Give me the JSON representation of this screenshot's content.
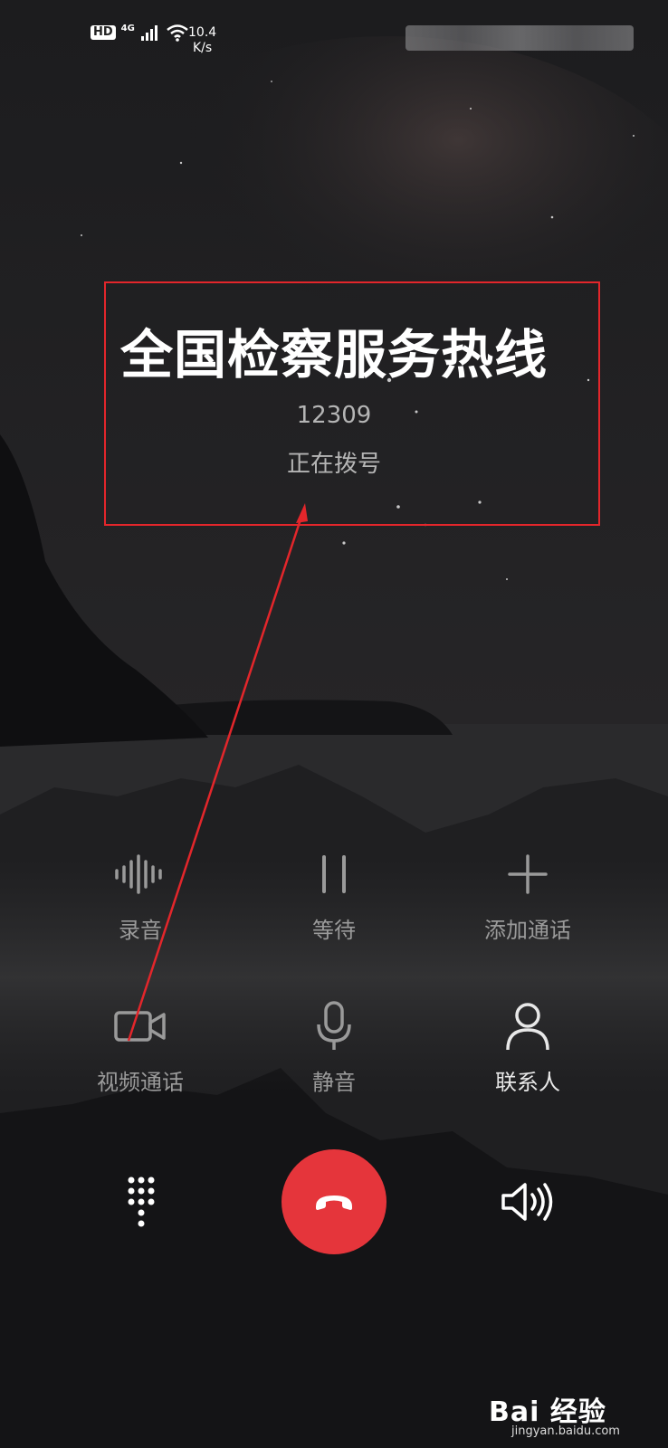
{
  "status_bar": {
    "hd_badge": "HD",
    "network": "4G",
    "speed_value": "10.4",
    "speed_unit": "K/s",
    "icons": [
      "signal-icon",
      "wifi-icon"
    ]
  },
  "call": {
    "caller_name": "全国检察服务热线",
    "number": "12309",
    "status": "正在拨号"
  },
  "controls": {
    "row1": [
      {
        "label": "录音",
        "icon": "record-waveform-icon"
      },
      {
        "label": "等待",
        "icon": "pause-icon"
      },
      {
        "label": "添加通话",
        "icon": "plus-icon"
      }
    ],
    "row2": [
      {
        "label": "视频通话",
        "icon": "video-camera-icon"
      },
      {
        "label": "静音",
        "icon": "microphone-icon"
      },
      {
        "label": "联系人",
        "icon": "person-icon"
      }
    ]
  },
  "bottom": {
    "left_icon": "dialpad-icon",
    "center_icon": "hang-up-icon",
    "right_icon": "speaker-icon"
  },
  "annotation": {
    "color": "#e3262b"
  },
  "watermark": {
    "text": "Bai 经验",
    "url_text": "jingyan.baidu.com"
  },
  "colors": {
    "hangup": "#e5353b",
    "background": "#1a1a1c"
  }
}
